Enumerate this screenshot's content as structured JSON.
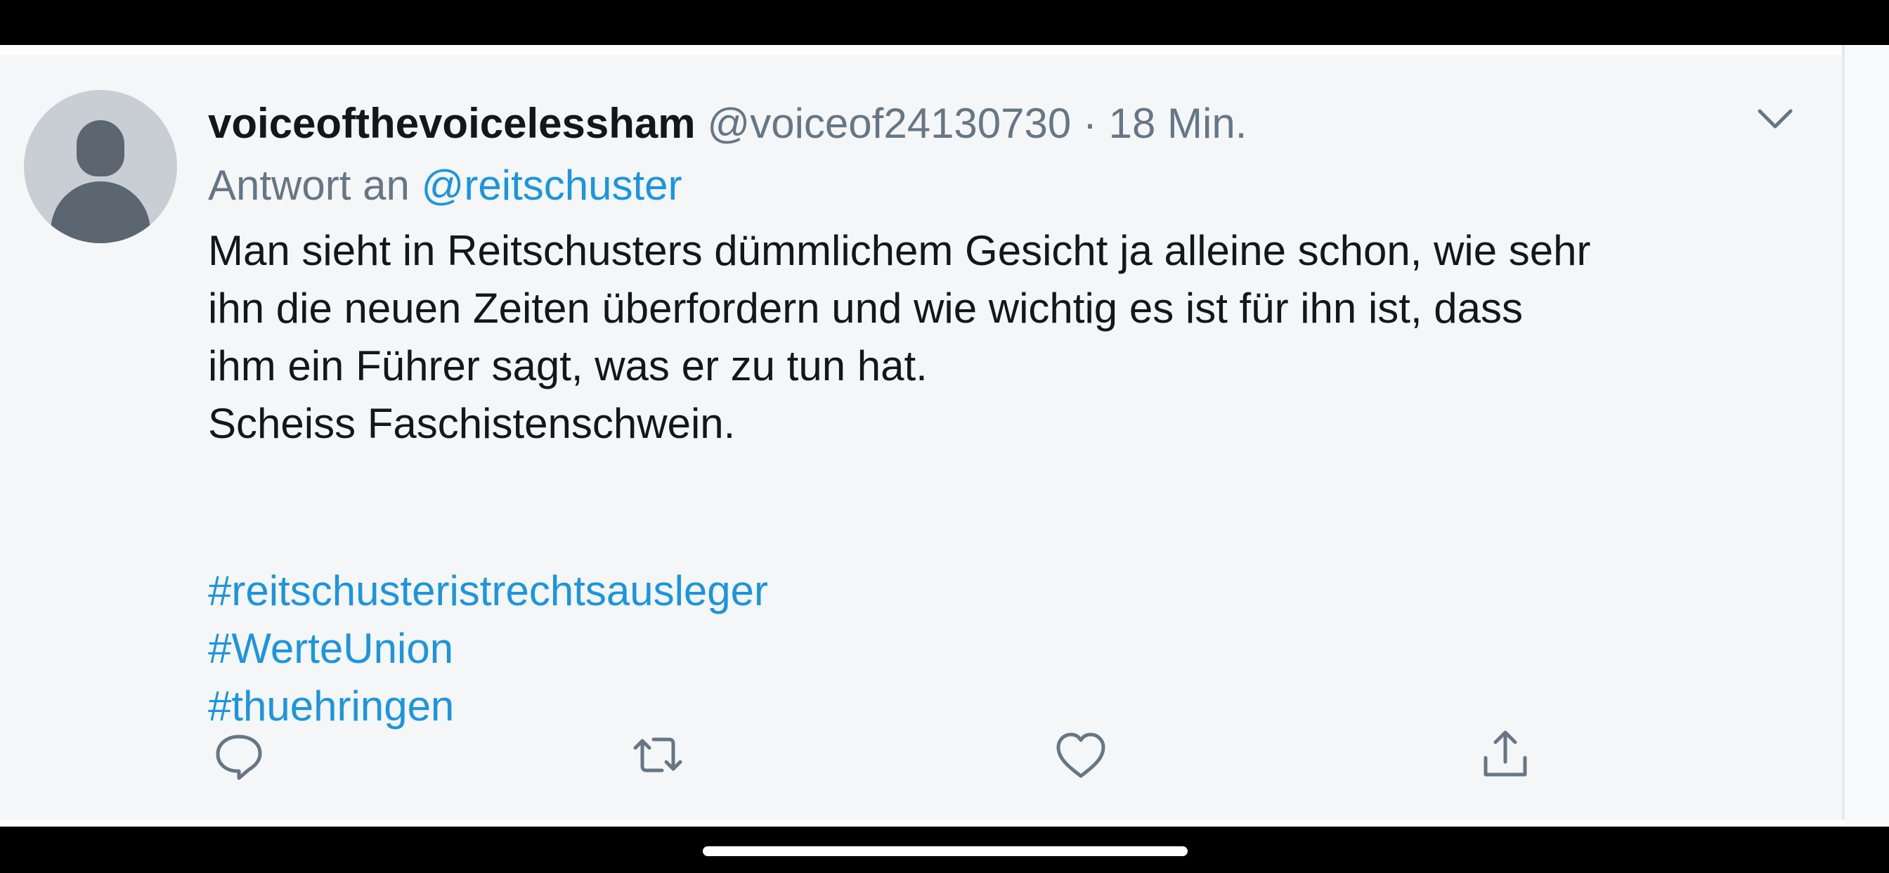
{
  "tweet": {
    "display_name": "voiceofthevoicelessham",
    "handle": "@voiceof24130730",
    "separator": "·",
    "time": "18 Min.",
    "reply_prefix": "Antwort an",
    "reply_to": "@reitschuster",
    "text_lines": [
      "Man sieht in Reitschusters dümmlichem Gesicht ja alleine schon, wie sehr",
      "ihn die neuen Zeiten überfordern und wie wichtig es ist für ihn ist, dass",
      "ihm ein Führer sagt, was er zu tun hat.",
      "Scheiss Faschistenschwein."
    ],
    "hashtags": [
      "#reitschusteristrechtsausleger",
      "#WerteUnion",
      "#thuehringen"
    ]
  },
  "icons": {
    "avatar": "default-avatar",
    "menu": "chevron-down-icon",
    "reply": "reply-icon",
    "retweet": "retweet-icon",
    "like": "like-icon",
    "share": "share-icon"
  },
  "colors": {
    "text": "#14171a",
    "secondary": "#657786",
    "link": "#1b95e0",
    "card_bg": "#f5f6f8"
  }
}
